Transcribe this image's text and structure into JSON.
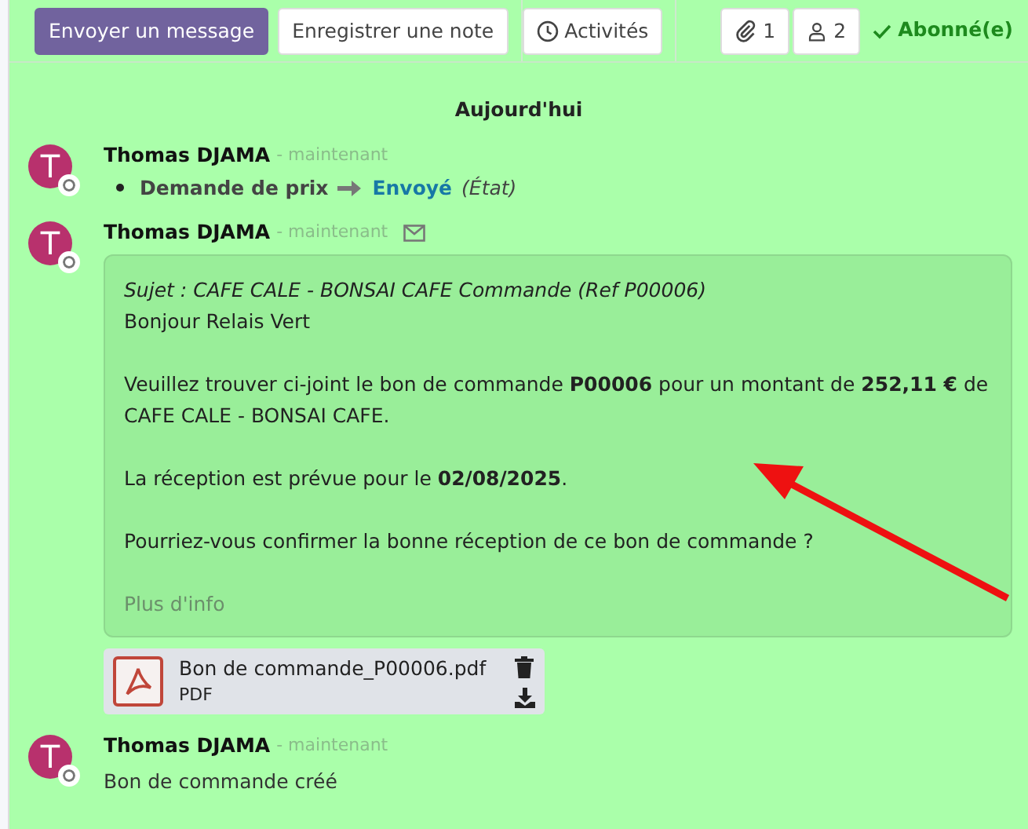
{
  "toolbar": {
    "buttons": [
      {
        "label": "Envoyer un message",
        "kind": "primary"
      },
      {
        "label": "Enregistrer une note",
        "kind": "secondary"
      },
      {
        "label": "Activités",
        "kind": "activity"
      }
    ],
    "attachments_count": "1",
    "followers_count": "2",
    "subscription": "Abonné(e)"
  },
  "date_separator": "Aujourd'hui",
  "messages": [
    {
      "kind": "tracking",
      "avatar_letter": "T",
      "author": "Thomas DJAMA",
      "time": "- maintenant",
      "field": "Demande de prix",
      "new_value": "Envoyé",
      "field_label": "(État)"
    },
    {
      "kind": "email",
      "avatar_letter": "T",
      "author": "Thomas DJAMA",
      "time": "- maintenant",
      "subject": "Sujet : CAFE CALE - BONSAI CAFE Commande (Ref P00006)",
      "paragraphs": [
        "Bonjour Relais Vert",
        "Veuillez trouver ci-joint le bon de commande **P00006** pour un montant de **252,11 €** de CAFE CALE - BONSAI CAFE.",
        "La réception est prévue pour le **02/08/2025**.",
        "Pourriez-vous confirmer la bonne réception de ce bon de commande ?"
      ],
      "more_link": "Plus d'info",
      "attachment": {
        "filename": "Bon de commande_P00006.pdf",
        "type": "PDF"
      }
    },
    {
      "kind": "note",
      "avatar_letter": "T",
      "author": "Thomas DJAMA",
      "time": "- maintenant",
      "body": "Bon de commande créé"
    }
  ]
}
